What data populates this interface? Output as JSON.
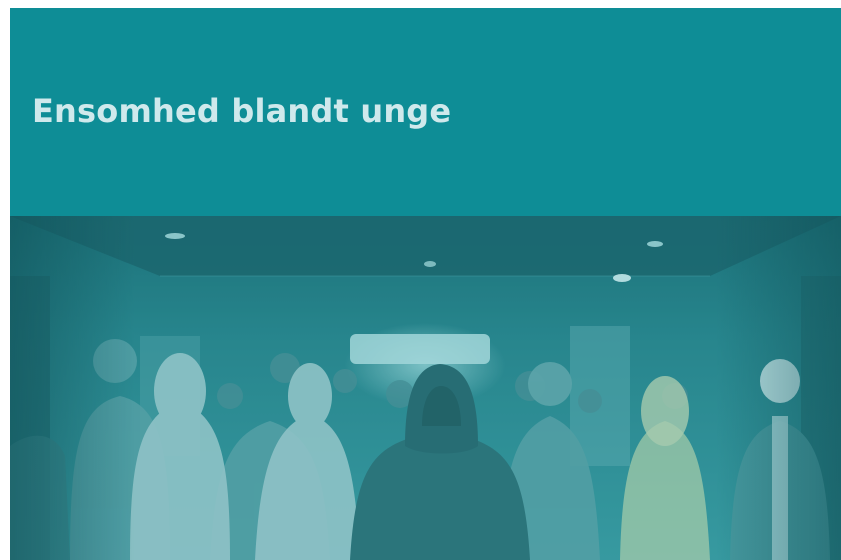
{
  "cover": {
    "title": "Ensomhed blandt unge",
    "colors": {
      "banner": "#0e8d96",
      "title_text": "#cfe9ec",
      "photo_tint": "#1a8e98"
    },
    "photo": {
      "subject": "crowd-of-young-people-walking-icon"
    }
  }
}
